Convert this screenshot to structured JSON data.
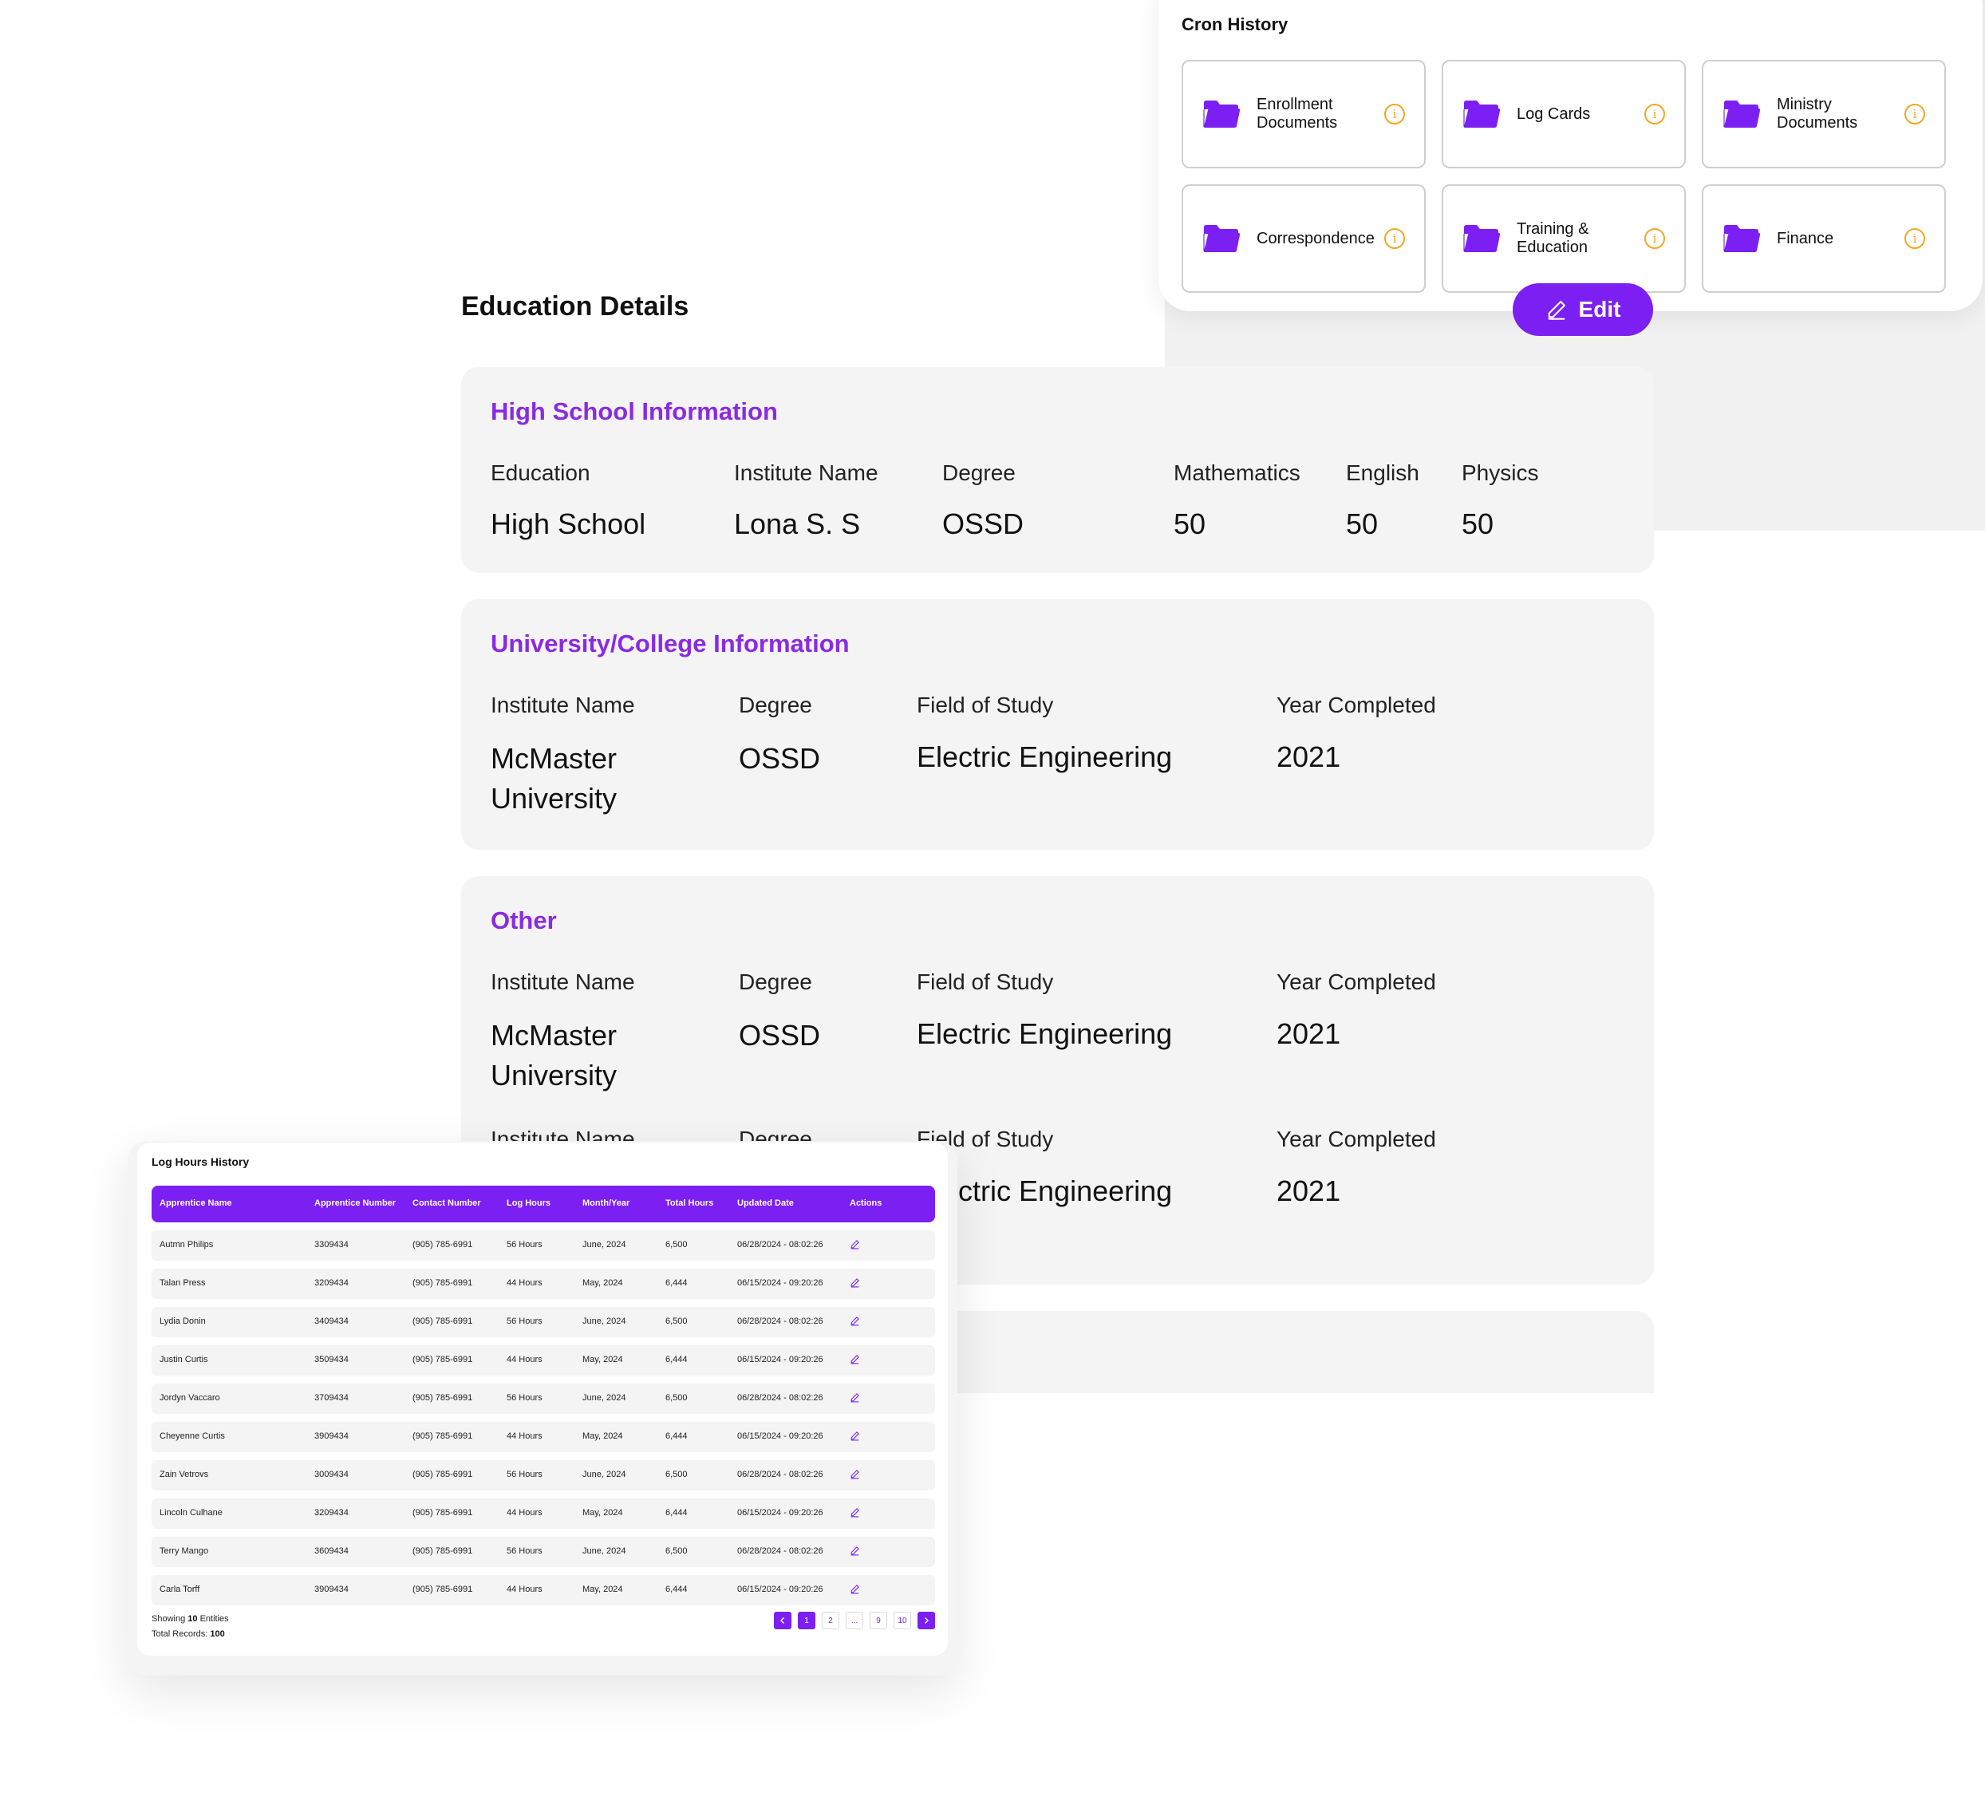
{
  "cron": {
    "title": "Cron History",
    "folders": [
      {
        "label": "Enrollment Documents",
        "icon": "folder-icon"
      },
      {
        "label": "Log Cards",
        "icon": "folder-icon"
      },
      {
        "label": "Ministry Documents",
        "icon": "folder-icon"
      },
      {
        "label": "Correspondence",
        "icon": "folder-icon"
      },
      {
        "label": "Training & Education",
        "icon": "folder-icon"
      },
      {
        "label": "Finance",
        "icon": "folder-icon"
      }
    ],
    "info_glyph": "i"
  },
  "education": {
    "title": "Education Details",
    "edit_label": "Edit",
    "high_school": {
      "title": "High School Information",
      "labels": [
        "Education",
        "Institute Name",
        "Degree",
        "Mathematics",
        "English",
        "Physics"
      ],
      "values": [
        "High School",
        "Lona S. S",
        "OSSD",
        "50",
        "50",
        "50"
      ]
    },
    "university": {
      "title": "University/College Information",
      "labels": [
        "Institute Name",
        "Degree",
        "Field of Study",
        "Year Completed"
      ],
      "values": [
        "McMaster University",
        "OSSD",
        "Electric Engineering",
        "2021"
      ]
    },
    "other": {
      "title": "Other",
      "row1": {
        "labels": [
          "Institute Name",
          "Degree",
          "Field of Study",
          "Year Completed"
        ],
        "values": [
          "McMaster University",
          "OSSD",
          "Electric Engineering",
          "2021"
        ]
      },
      "row2": {
        "labels": [
          "Institute Name",
          "Degree",
          "Field of Study",
          "Year Completed"
        ],
        "values": [
          "",
          "",
          "Electric Engineering",
          "2021"
        ]
      }
    }
  },
  "log": {
    "title": "Log Hours History",
    "columns": [
      "Apprentice Name",
      "Apprentice Number",
      "Contact Number",
      "Log Hours",
      "Month/Year",
      "Total Hours",
      "Updated Date",
      "Actions"
    ],
    "rows": [
      [
        "Autmn Philips",
        "3309434",
        "(905)  785-6991",
        "56 Hours",
        "June, 2024",
        "6,500",
        "06/28/2024 - 08:02:26"
      ],
      [
        "Talan Press",
        "3209434",
        "(905)  785-6991",
        "44 Hours",
        "May, 2024",
        "6,444",
        "06/15/2024 - 09:20:26"
      ],
      [
        "Lydia Donin",
        "3409434",
        "(905)  785-6991",
        "56 Hours",
        "June, 2024",
        "6,500",
        "06/28/2024 - 08:02:26"
      ],
      [
        "Justin Curtis",
        "3509434",
        "(905)  785-6991",
        "44 Hours",
        "May, 2024",
        "6,444",
        "06/15/2024 - 09:20:26"
      ],
      [
        "Jordyn Vaccaro",
        "3709434",
        "(905)  785-6991",
        "56 Hours",
        "June, 2024",
        "6,500",
        "06/28/2024 - 08:02:26"
      ],
      [
        "Cheyenne Curtis",
        "3909434",
        "(905)  785-6991",
        "44 Hours",
        "May, 2024",
        "6,444",
        "06/15/2024 - 09:20:26"
      ],
      [
        "Zain Vetrovs",
        "3009434",
        "(905)  785-6991",
        "56 Hours",
        "June, 2024",
        "6,500",
        "06/28/2024 - 08:02:26"
      ],
      [
        "Lincoln Culhane",
        "3209434",
        "(905)  785-6991",
        "44 Hours",
        "May, 2024",
        "6,444",
        "06/15/2024 - 09:20:26"
      ],
      [
        "Terry Mango",
        "3609434",
        "(905)  785-6991",
        "56 Hours",
        "June, 2024",
        "6,500",
        "06/28/2024 - 08:02:26"
      ],
      [
        "Carla Torff",
        "3909434",
        "(905)  785-6991",
        "44 Hours",
        "May, 2024",
        "6,444",
        "06/15/2024 - 09:20:26"
      ]
    ],
    "showing_prefix": "Showing ",
    "showing_count": "10",
    "showing_suffix": " Entities",
    "total_prefix": "Total Records: ",
    "total_count": "100",
    "pages": [
      "1",
      "2",
      "...",
      "9",
      "10"
    ],
    "active_page": "1"
  },
  "colors": {
    "accent": "#7b1ff2",
    "section_title": "#8a2be2",
    "info": "#f5a623",
    "card_bg": "#f4f4f4"
  }
}
